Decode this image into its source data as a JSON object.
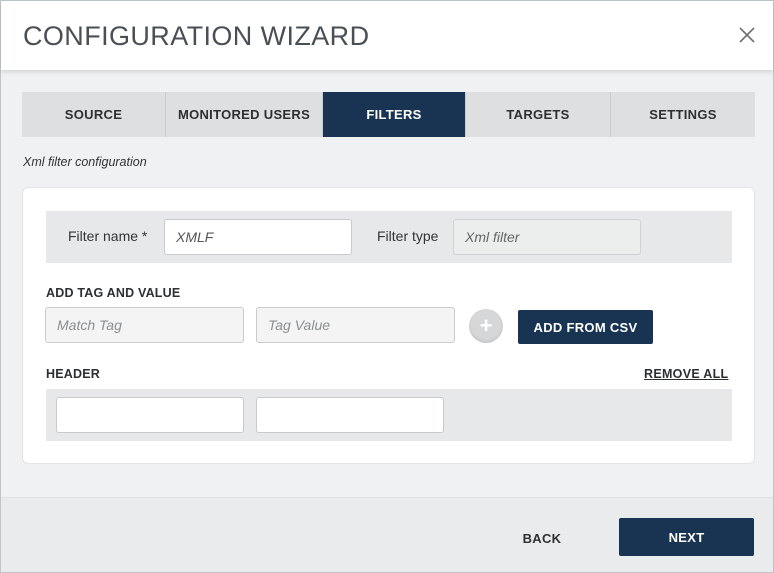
{
  "dialog": {
    "title": "CONFIGURATION WIZARD",
    "close_icon": "close-icon"
  },
  "tabs": [
    {
      "label": "SOURCE",
      "active": false
    },
    {
      "label": "MONITORED USERS",
      "active": false
    },
    {
      "label": "FILTERS",
      "active": true
    },
    {
      "label": "TARGETS",
      "active": false
    },
    {
      "label": "SETTINGS",
      "active": false
    }
  ],
  "section_caption": "Xml filter configuration",
  "filter": {
    "name_label": "Filter name *",
    "name_value": "XMLF",
    "type_label": "Filter type",
    "type_value": "Xml filter"
  },
  "add_tag": {
    "heading": "ADD TAG AND VALUE",
    "match_tag_placeholder": "Match Tag",
    "tag_value_placeholder": "Tag Value",
    "plus_symbol": "+",
    "add_csv_label": "ADD FROM CSV"
  },
  "header_section": {
    "heading": "HEADER",
    "remove_all_label": "REMOVE ALL",
    "field1_value": "",
    "field2_value": ""
  },
  "footer": {
    "back_label": "BACK",
    "next_label": "NEXT"
  },
  "colors": {
    "accent": "#183452",
    "tab_inactive": "#dedfe0",
    "panel_bg": "#f0f1f2"
  }
}
